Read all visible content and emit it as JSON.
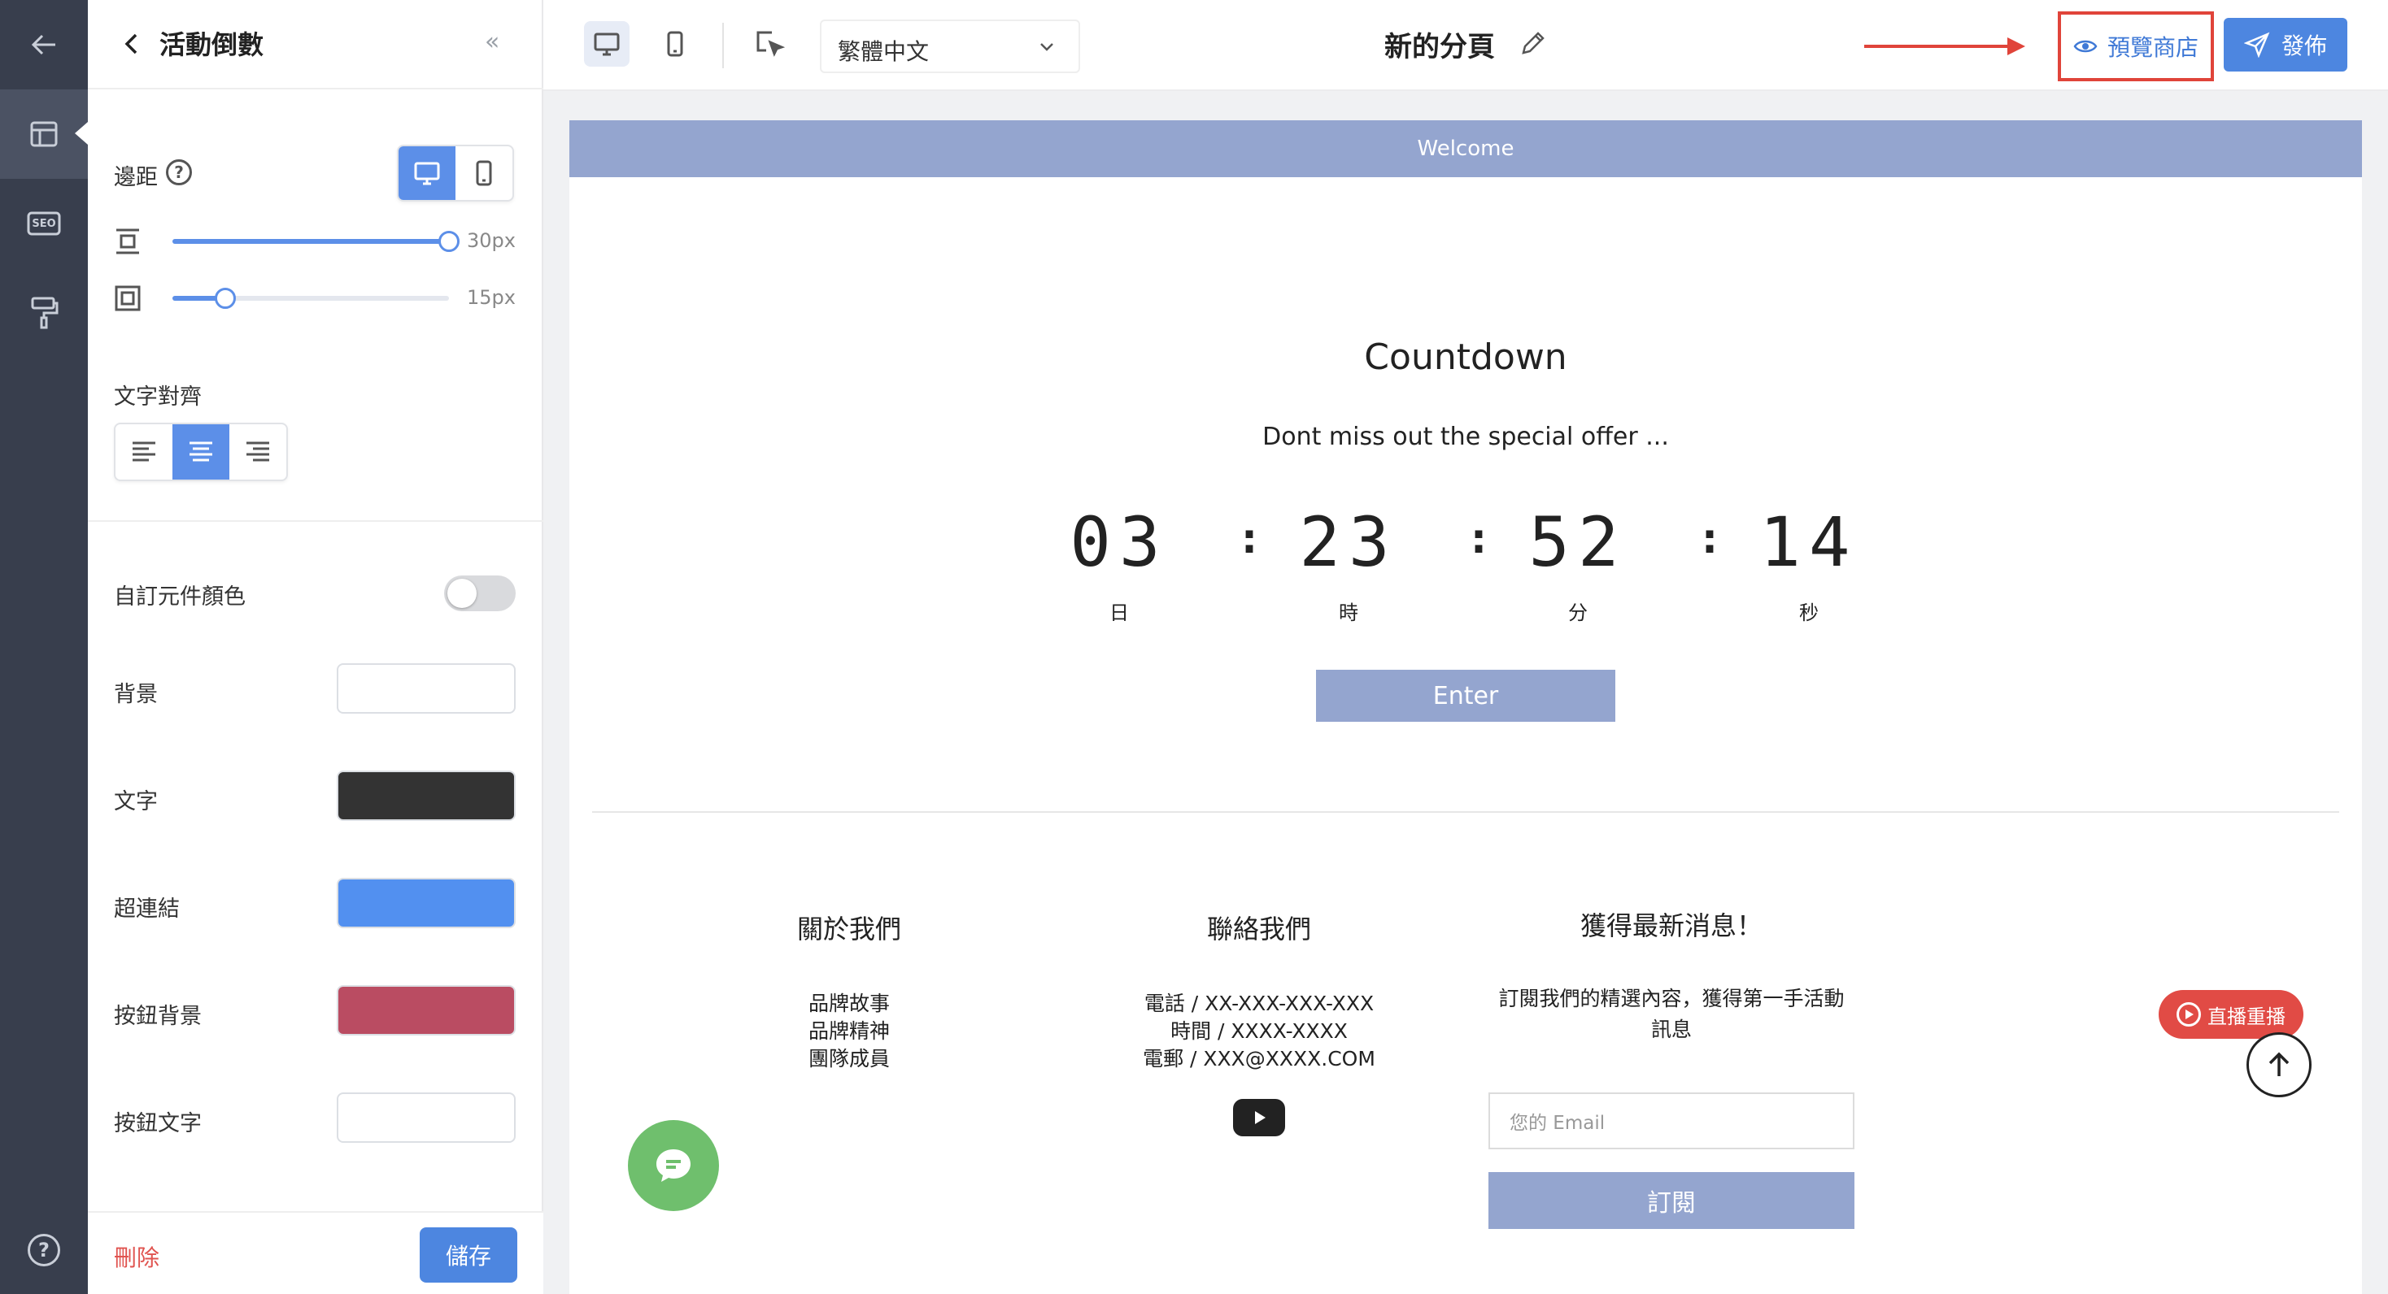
{
  "rail": {
    "items": [
      "back-arrow-icon",
      "layout-icon",
      "seo-icon",
      "paint-roller-icon"
    ],
    "seo_label": "SEO",
    "help": "?"
  },
  "panel": {
    "title": "活動倒數",
    "collapse": "«",
    "spacing_label": "邊距",
    "help_mark": "?",
    "spacing": [
      {
        "value": "30px",
        "fill": 1.0
      },
      {
        "value": "15px",
        "fill": 0.19
      }
    ],
    "align_label": "文字對齊",
    "custom_color_label": "自訂元件顏色",
    "custom_color_on": false,
    "colors": [
      {
        "label": "背景",
        "color": "#ffffff"
      },
      {
        "label": "文字",
        "color": "#333333"
      },
      {
        "label": "超連結",
        "color": "#5290f0"
      },
      {
        "label": "按鈕背景",
        "color": "#ba4c62"
      },
      {
        "label": "按鈕文字",
        "color": "#ffffff"
      }
    ],
    "delete": "刪除",
    "save": "儲存"
  },
  "topbar": {
    "language": "繁體中文",
    "page_name": "新的分頁",
    "preview": "預覽商店",
    "publish": "發佈"
  },
  "page": {
    "welcome": "Welcome",
    "countdown": {
      "title": "Countdown",
      "subtitle": "Dont miss out the special offer ...",
      "units": [
        {
          "value": "03",
          "label": "日"
        },
        {
          "value": "23",
          "label": "時"
        },
        {
          "value": "52",
          "label": "分"
        },
        {
          "value": "14",
          "label": "秒"
        }
      ],
      "separator": ":",
      "enter": "Enter"
    },
    "footer": {
      "about": {
        "title": "關於我們",
        "lines": [
          "品牌故事",
          "品牌精神",
          "團隊成員"
        ]
      },
      "contact": {
        "title": "聯絡我們",
        "lines": [
          "電話 / XX-XXX-XXX-XXX",
          "時間 / XXXX-XXXX",
          "電郵 / XXX@XXXX.COM"
        ]
      },
      "news": {
        "title": "獲得最新消息！",
        "text": [
          "訂閱我們的精選內容，獲得第一手活動",
          "訊息"
        ],
        "email_placeholder": "您的 Email",
        "subscribe": "訂閱"
      }
    },
    "live_replay": "直播重播"
  },
  "accent": "#4d86e0",
  "welcome_color": "#94a5cf"
}
